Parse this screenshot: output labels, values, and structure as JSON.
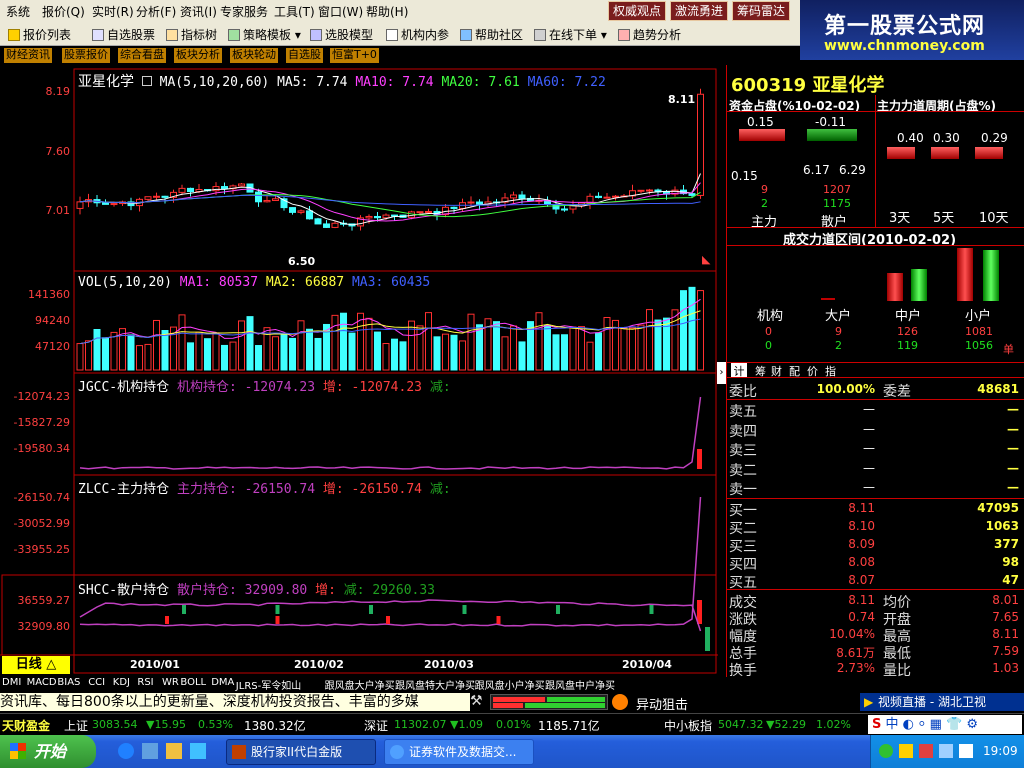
{
  "menu": [
    "系统",
    "报价(Q)",
    "实时(R)",
    "分析(F)",
    "资讯(I)",
    "专家服务",
    "工具(T)",
    "窗口(W)",
    "帮助(H)"
  ],
  "menu_buttons": [
    "权威观点",
    "激流勇进",
    "筹码雷达"
  ],
  "toolbar": [
    "报价列表",
    "自选股票",
    "指标树",
    "策略模板",
    "选股模型",
    "机构内参",
    "帮助社区",
    "在线下单",
    "趋势分析"
  ],
  "banner": {
    "title": "第一股票公式网",
    "url": "www.chnmoney.com"
  },
  "tabs": [
    "财经资讯",
    "股票报价",
    "综合看盘",
    "板块分析",
    "板块轮动",
    "自选股",
    "恒富T+0"
  ],
  "price_pane": {
    "name": "亚星化学",
    "title": "MA(5,10,20,60)",
    "ma5": "MA5: 7.74",
    "ma10": "MA10: 7.74",
    "ma20": "MA20: 7.61",
    "ma60": "MA60: 7.22",
    "yticks": [
      "8.19",
      "7.60",
      "7.01"
    ],
    "high_label": "8.11",
    "low_label": "6.50"
  },
  "vol_pane": {
    "title": "VOL(5,10,20)",
    "ma1": "MA1: 80537",
    "ma2": "MA2: 66887",
    "ma3": "MA3: 60435",
    "yticks": [
      "141360",
      "94240",
      "47120"
    ]
  },
  "jgcc_pane": {
    "title": "JGCC-机构持仓",
    "a": "机构持仓: -12074.23",
    "b": "增: -12074.23",
    "c": "减:",
    "yticks": [
      "-12074.23",
      "-15827.29",
      "-19580.34"
    ]
  },
  "zlcc_pane": {
    "title": "ZLCC-主力持仓",
    "a": "主力持仓: -26150.74",
    "b": "增: -26150.74",
    "c": "减:",
    "yticks": [
      "-26150.74",
      "-30052.99",
      "-33955.25"
    ]
  },
  "shcc_pane": {
    "title": "SHCC-散户持仓",
    "a": "散户持仓: 32909.80",
    "b": "增:",
    "c": "减: 29260.33",
    "yticks": [
      "36559.27",
      "32909.80"
    ]
  },
  "xaxis": {
    "period_label": "日线 △",
    "dates": [
      "2010/01",
      "2010/02",
      "2010/03",
      "2010/04"
    ]
  },
  "right": {
    "code_name": "600319 亚星化学",
    "hdr1": "资金占盘(%10-02-02)",
    "hdr2": "主力力道周期(占盘%)",
    "fund_top": [
      "0.15",
      "-0.11"
    ],
    "fund_mid": [
      "0.15",
      "6.17",
      "6.29"
    ],
    "fund_red": [
      "9",
      "1207"
    ],
    "fund_green": [
      "2",
      "1175"
    ],
    "fund_labels": [
      "主力",
      "散户"
    ],
    "cycle_vals": [
      "0.40",
      "0.30",
      "0.29"
    ],
    "cycle_labels": [
      "3天",
      "5天",
      "10天"
    ],
    "range_title": "成交力道区间(2010-02-02)",
    "range_labels": [
      "机构",
      "大户",
      "中户",
      "小户"
    ],
    "range_red": [
      "0",
      "9",
      "126",
      "1081"
    ],
    "range_green": [
      "0",
      "2",
      "119",
      "1056"
    ],
    "range_unit": "单",
    "tabs": [
      "计",
      "筹",
      "财",
      "配",
      "价",
      "指"
    ],
    "weibi": {
      "l": "委比",
      "v": "100.00%",
      "l2": "委差",
      "v2": "48681"
    },
    "sells": [
      {
        "l": "卖五",
        "p": "—",
        "v": "—"
      },
      {
        "l": "卖四",
        "p": "—",
        "v": "—"
      },
      {
        "l": "卖三",
        "p": "—",
        "v": "—"
      },
      {
        "l": "卖二",
        "p": "—",
        "v": "—"
      },
      {
        "l": "卖一",
        "p": "—",
        "v": "—"
      }
    ],
    "buys": [
      {
        "l": "买一",
        "p": "8.11",
        "v": "47095"
      },
      {
        "l": "买二",
        "p": "8.10",
        "v": "1063"
      },
      {
        "l": "买三",
        "p": "8.09",
        "v": "377"
      },
      {
        "l": "买四",
        "p": "8.08",
        "v": "98"
      },
      {
        "l": "买五",
        "p": "8.07",
        "v": "47"
      }
    ],
    "quotes": [
      {
        "l1": "成交",
        "v1": "8.11",
        "l2": "均价",
        "v2": "8.01"
      },
      {
        "l1": "涨跌",
        "v1": "0.74",
        "l2": "开盘",
        "v2": "7.65"
      },
      {
        "l1": "幅度",
        "v1": "10.04%",
        "l2": "最高",
        "v2": "8.11"
      },
      {
        "l1": "总手",
        "v1": "8.61万",
        "l2": "最低",
        "v2": "7.59"
      },
      {
        "l1": "换手",
        "v1": "2.73%",
        "l2": "量比",
        "v2": "1.03"
      }
    ]
  },
  "indicators": [
    "DMI",
    "MACD",
    "BIAS",
    "CCI",
    "KDJ",
    "RSI",
    "WR",
    "BOLL",
    "DMA",
    "JLRS-军令如山",
    "跟风盘大户净买",
    "跟风盘特大户净买",
    "跟风盘小户净买",
    "跟风盘中户净买"
  ],
  "ticker": {
    "text": "资讯库、每日800条以上的更新量、深度机构投资报告、丰富的多媒",
    "btn": "异动狙击",
    "video": "视频直播 - 湖北卫视"
  },
  "indexbar": {
    "brand": "天财盈金",
    "sh_name": "上证",
    "sh_val": "3083.54",
    "sh_chg": "▼15.95",
    "sh_pct": "0.53%",
    "sh_amt": "1380.32亿",
    "sz_name": "深证",
    "sz_val": "11302.07",
    "sz_chg": "▼1.09",
    "sz_pct": "0.01%",
    "sz_amt": "1185.71亿",
    "zx_name": "中小板指",
    "zx_val": "5047.32",
    "zx_chg": "▼52.29",
    "zx_pct": "1.02%"
  },
  "taskbar": {
    "start": "开始",
    "win1": "股行家II代白金版",
    "win2": "证券软件及数据交...",
    "time": "19:09"
  }
}
